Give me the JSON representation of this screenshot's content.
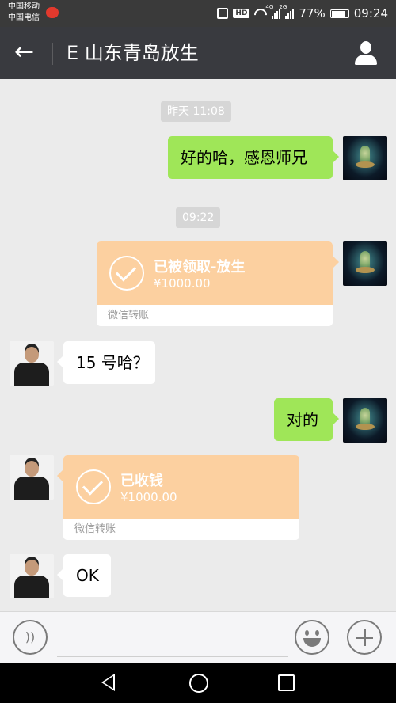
{
  "statusbar": {
    "carrier1": "中国移动",
    "carrier2": "中国电信",
    "hd": "HD",
    "net1": "4G",
    "net2": "2G",
    "battery": "77%",
    "time": "09:24"
  },
  "header": {
    "title": "E 山东青岛放生",
    "back_icon": "arrow-left-icon",
    "profile_icon": "person-icon"
  },
  "messages": {
    "ts1": "昨天 11:08",
    "m1": "好的哈，感恩师兄",
    "ts2": "09:22",
    "t1": {
      "title": "已被领取-放生",
      "amount": "¥1000.00",
      "footer": "微信转账"
    },
    "m2": "15 号哈？",
    "m3": "对的",
    "t2": {
      "title": "已收钱",
      "amount": "¥1000.00",
      "footer": "微信转账"
    },
    "m4": "OK"
  },
  "colors": {
    "header_bg": "#393a3f",
    "sent_bubble": "#9fe658",
    "received_bubble": "#ffffff",
    "transfer_card": "#fcd0a0",
    "chat_bg": "#ebebeb"
  },
  "inputbar": {
    "voice_icon": "voice-icon",
    "emoji_icon": "emoji-icon",
    "plus_icon": "plus-icon"
  }
}
